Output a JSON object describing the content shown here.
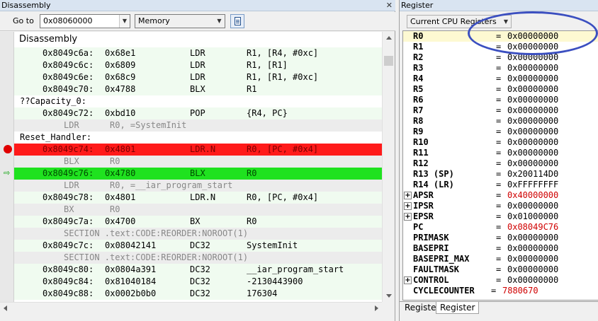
{
  "disassembly": {
    "title": "Disassembly",
    "goto_label": "Go to",
    "goto_value": "0x08060000",
    "memory_combo": "Memory",
    "header": "Disassembly",
    "lines": [
      {
        "type": "code",
        "addr": "0x8049c6a:",
        "code": "0x68e1",
        "mn": "LDR",
        "op": "R1, [R4, #0xc]"
      },
      {
        "type": "code",
        "addr": "0x8049c6c:",
        "code": "0x6809",
        "mn": "LDR",
        "op": "R1, [R1]"
      },
      {
        "type": "code",
        "addr": "0x8049c6e:",
        "code": "0x68c9",
        "mn": "LDR",
        "op": "R1, [R1, #0xc]"
      },
      {
        "type": "code",
        "addr": "0x8049c70:",
        "code": "0x4788",
        "mn": "BLX",
        "op": "R1"
      },
      {
        "type": "label",
        "text": "??Capacity_0:"
      },
      {
        "type": "code",
        "addr": "0x8049c72:",
        "code": "0xbd10",
        "mn": "POP",
        "op": "{R4, PC}"
      },
      {
        "type": "src",
        "s1": "LDR",
        "s2": "R0, =SystemInit"
      },
      {
        "type": "label",
        "text": "Reset_Handler:"
      },
      {
        "type": "code",
        "hl": "red",
        "addr": "0x8049c74:",
        "code": "0x4801",
        "mn": "LDR.N",
        "op": "R0, [PC, #0x4]"
      },
      {
        "type": "src",
        "s1": "BLX",
        "s2": "R0"
      },
      {
        "type": "code",
        "hl": "green",
        "addr": "0x8049c76:",
        "code": "0x4780",
        "mn": "BLX",
        "op": "R0"
      },
      {
        "type": "src",
        "s1": "LDR",
        "s2": "R0, =__iar_program_start"
      },
      {
        "type": "code",
        "addr": "0x8049c78:",
        "code": "0x4801",
        "mn": "LDR.N",
        "op": "R0, [PC, #0x4]"
      },
      {
        "type": "src",
        "s1": "BX",
        "s2": "R0"
      },
      {
        "type": "code",
        "addr": "0x8049c7a:",
        "code": "0x4700",
        "mn": "BX",
        "op": "R0"
      },
      {
        "type": "src",
        "s1": "SECTION .text:CODE:REORDER:NOROOT(1)",
        "s2": ""
      },
      {
        "type": "code",
        "addr": "0x8049c7c:",
        "code": "0x08042141",
        "mn": "DC32",
        "op": "SystemInit"
      },
      {
        "type": "src",
        "s1": "SECTION .text:CODE:REORDER:NOROOT(1)",
        "s2": ""
      },
      {
        "type": "code",
        "addr": "0x8049c80:",
        "code": "0x0804a391",
        "mn": "DC32",
        "op": "__iar_program_start"
      },
      {
        "type": "code",
        "addr": "0x8049c84:",
        "code": "0x81040184",
        "mn": "DC32",
        "op": "-2130443900"
      },
      {
        "type": "code",
        "addr": "0x8049c88:",
        "code": "0x0002b0b0",
        "mn": "DC32",
        "op": "176304"
      }
    ]
  },
  "register": {
    "title": "Register",
    "combo": "Current CPU Registers",
    "rows": [
      {
        "name": "R0",
        "value": "0x00000000",
        "hl": true
      },
      {
        "name": "R1",
        "value": "0x00000000"
      },
      {
        "name": "R2",
        "value": "0x00000000"
      },
      {
        "name": "R3",
        "value": "0x00000000"
      },
      {
        "name": "R4",
        "value": "0x00000000"
      },
      {
        "name": "R5",
        "value": "0x00000000"
      },
      {
        "name": "R6",
        "value": "0x00000000"
      },
      {
        "name": "R7",
        "value": "0x00000000"
      },
      {
        "name": "R8",
        "value": "0x00000000"
      },
      {
        "name": "R9",
        "value": "0x00000000"
      },
      {
        "name": "R10",
        "value": "0x00000000"
      },
      {
        "name": "R11",
        "value": "0x00000000"
      },
      {
        "name": "R12",
        "value": "0x00000000"
      },
      {
        "name": "R13 (SP)",
        "value": "0x200114D0"
      },
      {
        "name": "R14 (LR)",
        "value": "0xFFFFFFFF"
      },
      {
        "name": "APSR",
        "value": "0x40000000",
        "expand": true,
        "changed": true
      },
      {
        "name": "IPSR",
        "value": "0x00000000",
        "expand": true
      },
      {
        "name": "EPSR",
        "value": "0x01000000",
        "expand": true
      },
      {
        "name": "PC",
        "value": "0x08049C76",
        "changed": true
      },
      {
        "name": "PRIMASK",
        "value": "0x00000000"
      },
      {
        "name": "BASEPRI",
        "value": "0x00000000"
      },
      {
        "name": "BASEPRI_MAX",
        "value": "0x00000000"
      },
      {
        "name": "FAULTMASK",
        "value": "0x00000000"
      },
      {
        "name": "CONTROL",
        "value": "0x00000000",
        "expand": true
      },
      {
        "name": "CYCLECOUNTER",
        "value": "7880670",
        "changed": true,
        "long": true
      }
    ],
    "equals": "=",
    "expand_glyph": "+",
    "tabs": [
      "Register",
      "Register"
    ]
  }
}
